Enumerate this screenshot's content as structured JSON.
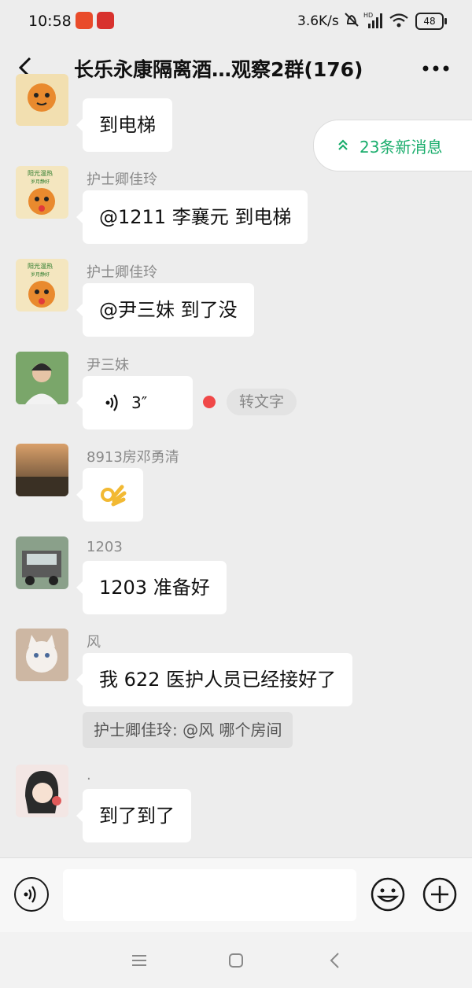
{
  "status": {
    "time": "10:58",
    "speed": "3.6K/s",
    "hd": "HD",
    "battery": "48"
  },
  "header": {
    "title": "长乐永康隔离酒…观察2群(176)"
  },
  "new_messages": {
    "label": "23条新消息"
  },
  "messages": [
    {
      "sender": "",
      "text": "到电梯"
    },
    {
      "sender": "护士卿佳玲",
      "text": "@1211 李襄元  到电梯"
    },
    {
      "sender": "护士卿佳玲",
      "text": "@尹三妹  到了没"
    },
    {
      "sender": "尹三妹",
      "voice_duration": "3″",
      "to_text_label": "转文字"
    },
    {
      "sender": "8913房邓勇清",
      "emoji": "ok-hand"
    },
    {
      "sender": "1203",
      "text": "1203 准备好"
    },
    {
      "sender": "风",
      "text": "我 622 医护人员已经接好了",
      "quote": "护士卿佳玲: @风 哪个房间"
    },
    {
      "sender": ".",
      "text": "到了到了"
    }
  ],
  "avatar_labels": {
    "nurse_line1": "阳光温热",
    "nurse_line2": "岁月静好"
  },
  "colors": {
    "accent": "#1aad6c",
    "unread_dot": "#f04848",
    "background": "#ededed"
  }
}
